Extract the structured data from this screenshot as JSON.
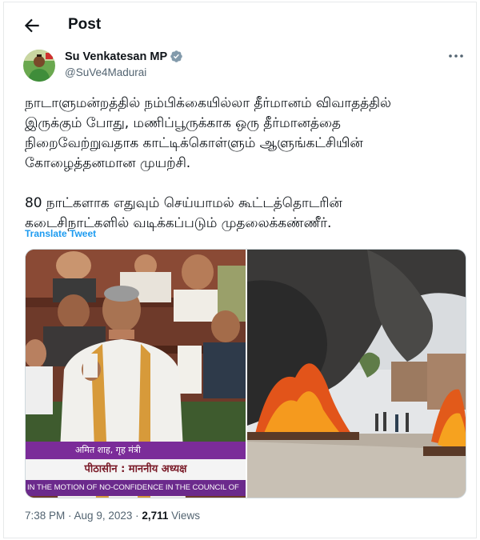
{
  "header": {
    "title": "Post"
  },
  "author": {
    "name": "Su Venkatesan MP",
    "handle": "@SuVe4Madurai",
    "verified": true
  },
  "tweet": {
    "lines": [
      "நாடாளுமன்றத்தில் நம்பிக்கையில்லா தீர்மானம் விவாதத்தில்",
      "இருக்கும் போது, மணிப்பூருக்காக ஒரு தீர்மானத்தை",
      "நிறைவேற்றுவதாக காட்டிக்கொள்ளும் ஆளுங்கட்சியின்",
      "கோழைத்தனமான முயற்சி.",
      "",
      "80 நாட்களாக எதுவும் செய்யாமல் கூட்டத்தொடரின்",
      "கடைசிநாட்களில் வடிக்கப்படும் முதலைக்கண்ணீர்."
    ],
    "translate_label": "Translate Tweet"
  },
  "media": {
    "left_image": {
      "caption_name": "अमित शाह, गृह मंत्री",
      "caption_chair": "पीठासीन : माननीय अध्यक्ष",
      "caption_motion": "IN THE MOTION OF NO-CONFIDENCE IN THE COUNCIL OF"
    }
  },
  "meta": {
    "time": "7:38 PM",
    "separator": " · ",
    "date": "Aug 9, 2023",
    "views_count": "2,711",
    "views_label": " Views"
  },
  "colors": {
    "link": "#1d9bf0",
    "secondary_text": "#536471",
    "verified_badge": "#829aab"
  }
}
